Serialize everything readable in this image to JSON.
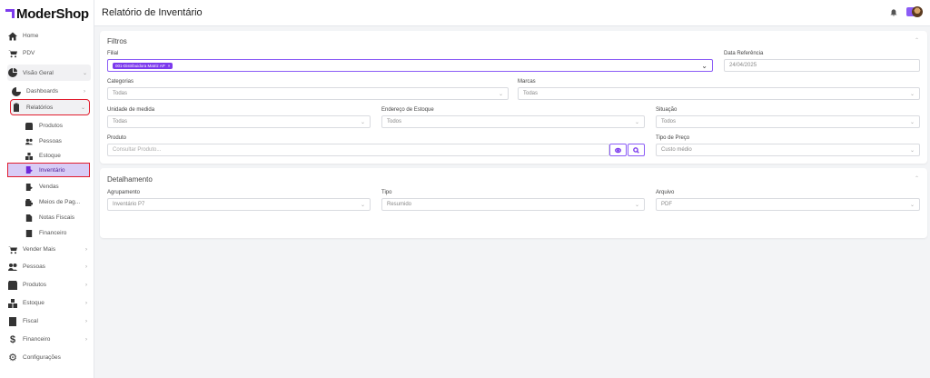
{
  "app": {
    "logo_text": "ModerShop"
  },
  "header": {
    "title": "Relatório de Inventário"
  },
  "sidebar": {
    "home": "Home",
    "pdv": "PDV",
    "visao_geral": "Visão Geral",
    "dashboards": "Dashboards",
    "relatorios": "Relatórios",
    "rel_items": [
      "Produtos",
      "Pessoas",
      "Estoque",
      "Inventário",
      "Vendas",
      "Meios de Pag...",
      "Notas Fiscais",
      "Financeiro"
    ],
    "vender_mais": "Vender Mais",
    "pessoas": "Pessoas",
    "produtos": "Produtos",
    "estoque": "Estoque",
    "fiscal": "Fiscal",
    "financeiro": "Financeiro",
    "configuracoes": "Configurações"
  },
  "filtros": {
    "title": "Filtros",
    "filial_label": "Filial",
    "filial_tag": "001-Distribuidora Matriz AP",
    "data_ref_label": "Data Referência",
    "data_ref_value": "24/04/2025",
    "categorias_label": "Categorias",
    "categorias_value": "Todas",
    "marcas_label": "Marcas",
    "marcas_value": "Todas",
    "unidade_label": "Unidade de medida",
    "unidade_value": "Todas",
    "endereco_label": "Endereço de Estoque",
    "endereco_value": "Todos",
    "situacao_label": "Situação",
    "situacao_value": "Todos",
    "produto_label": "Produto",
    "produto_placeholder": "Consultar Produto...",
    "tipo_preco_label": "Tipo de Preço",
    "tipo_preco_value": "Custo médio"
  },
  "detalhamento": {
    "title": "Detalhamento",
    "agrupamento_label": "Agrupamento",
    "agrupamento_value": "Inventário P7",
    "tipo_label": "Tipo",
    "tipo_value": "Resumido",
    "arquivo_label": "Arquivo",
    "arquivo_value": "PDF"
  },
  "colors": {
    "accent": "#7c3aed",
    "highlight": "#e11d2e"
  }
}
